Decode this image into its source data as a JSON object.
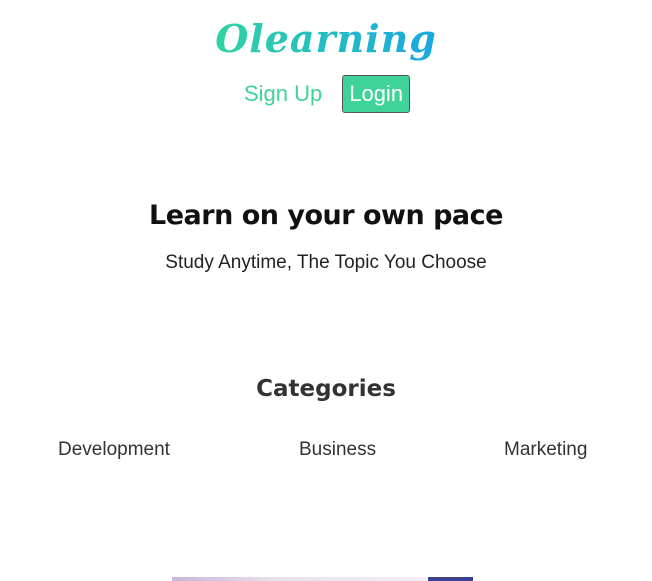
{
  "brand": {
    "logo_text": "Olearning",
    "logo_color_start": "#2fd3a3",
    "logo_color_end": "#1aa7e0"
  },
  "nav": {
    "signup_label": "Sign Up",
    "login_label": "Login",
    "accent": "#3fd39a"
  },
  "hero": {
    "title": "Learn on your own pace",
    "subtitle": "Study Anytime, The Topic You Choose"
  },
  "categories": {
    "title": "Categories",
    "items": [
      "Development",
      "Business",
      "Marketing"
    ]
  }
}
